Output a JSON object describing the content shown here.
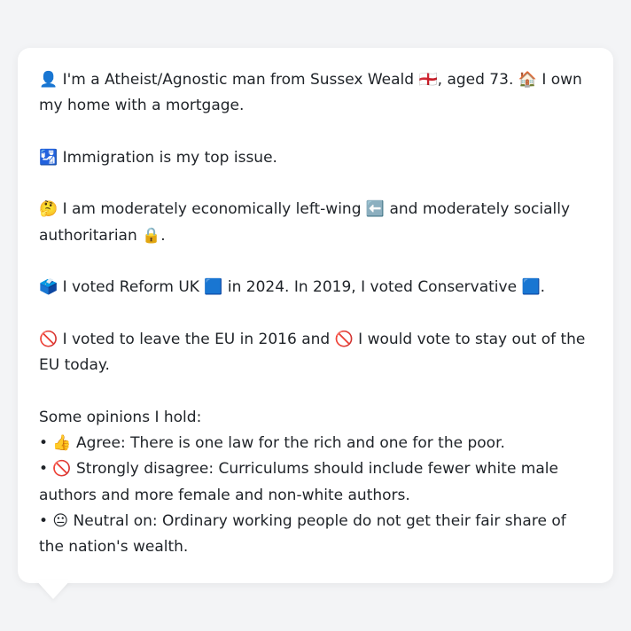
{
  "profile": {
    "intro": "👤 I'm a Atheist/Agnostic man from Sussex Weald 🏴󠁧󠁢󠁥󠁮󠁧󠁿, aged 73. 🏠 I own my home with a mortgage.",
    "top_issue": "🛂 Immigration is my top issue.",
    "ideology": "🤔 I am moderately economically left-wing ⬅️ and moderately socially authoritarian 🔒.",
    "votes": "🗳️ I voted Reform UK 🟦 in 2024. In 2019, I voted Conservative 🟦.",
    "eu": "🚫 I voted to leave the EU in 2016 and 🚫 I would vote to stay out of the EU today.",
    "opinions_heading": "Some opinions I hold:",
    "opinions": [
      "• 👍 Agree: There is one law for the rich and one for the poor.",
      "• 🚫 Strongly disagree: Curriculums should include fewer white male authors and more female and non-white authors.",
      "• 😐 Neutral on: Ordinary working people do not get their fair share of the nation's wealth."
    ]
  }
}
